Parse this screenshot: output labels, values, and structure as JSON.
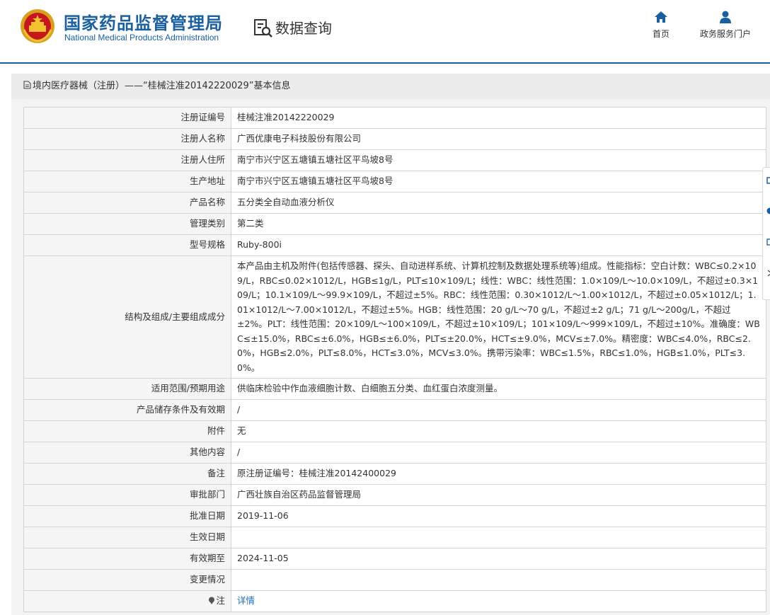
{
  "header": {
    "agency_cn": "国家药品监督管理局",
    "agency_en": "National Medical Products Administration",
    "section_title": "数据查询",
    "nav": [
      {
        "label": "首页",
        "icon": "home-icon"
      },
      {
        "label": "政务服务门户",
        "icon": "user-icon"
      }
    ]
  },
  "panel": {
    "title": "境内医疗器械（注册）——“桂械注准20142220029”基本信息"
  },
  "rows": [
    {
      "label": "注册证编号",
      "value": "桂械注准20142220029"
    },
    {
      "label": "注册人名称",
      "value": "广西优康电子科技股份有限公司"
    },
    {
      "label": "注册人住所",
      "value": "南宁市兴宁区五塘镇五塘社区平鸟坡8号"
    },
    {
      "label": "生产地址",
      "value": "南宁市兴宁区五塘镇五塘社区平鸟坡8号"
    },
    {
      "label": "产品名称",
      "value": "五分类全自动血液分析仪"
    },
    {
      "label": "管理类别",
      "value": "第二类"
    },
    {
      "label": "型号规格",
      "value": "Ruby-800i"
    },
    {
      "label": "结构及组成/主要组成成分",
      "value": "本产品由主机及附件(包括传感器、探头、自动进样系统、计算机控制及数据处理系统等)组成。性能指标：空白计数：WBC≤0.2×109/L，RBC≤0.02×1012/L，HGB≤1g/L，PLT≤10×109/L；线性：WBC：线性范围：1.0×109/L～10.0×109/L，不超过±0.3×109/L；10.1×109/L～99.9×109/L，不超过±5%。RBC：线性范围：0.30×1012/L～1.00×1012/L，不超过±0.05×1012/L；1.01×1012/L～7.00×1012/L，不超过±5%。HGB：线性范围：20 g/L～70 g/L，不超过±2 g/L；71 g/L～200g/L，不超过±2%。PLT：线性范围：20×109/L～100×109/L，不超过±10×109/L；101×109/L～999×109/L，不超过±10%。准确度：WBC≤±15.0%，RBC≤±6.0%，HGB≤±6.0%，PLT≤±20.0%，HCT≤±9.0%，MCV≤±7.0%。精密度：WBC≤4.0%，RBC≤2.0%，HGB≤2.0%，PLT≤8.0%，HCT≤3.0%，MCV≤3.0%。携带污染率：WBC≤1.5%，RBC≤1.0%，HGB≤1.0%，PLT≤3.0%。"
    },
    {
      "label": "适用范围/预期用途",
      "value": "供临床检验中作血液细胞计数、白细胞五分类、血红蛋白浓度测量。"
    },
    {
      "label": "产品储存条件及有效期",
      "value": "/"
    },
    {
      "label": "附件",
      "value": "无"
    },
    {
      "label": "其他内容",
      "value": "/"
    },
    {
      "label": "备注",
      "value": "原注册证编号：桂械注准20142400029"
    },
    {
      "label": "审批部门",
      "value": "广西壮族自治区药品监督管理局"
    },
    {
      "label": "批准日期",
      "value": "2019-11-06"
    },
    {
      "label": "生效日期",
      "value": ""
    },
    {
      "label": "有效期至",
      "value": "2024-11-05"
    },
    {
      "label": "变更情况",
      "value": ""
    },
    {
      "label": "注",
      "value": "详情",
      "label_icon": "pin-icon"
    }
  ]
}
